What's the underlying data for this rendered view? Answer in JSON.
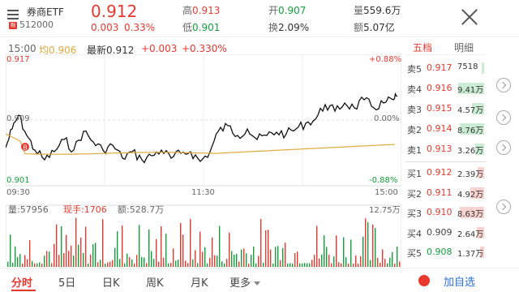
{
  "header": {
    "name": "券商ETF",
    "code_badge": "融",
    "code": "512000",
    "price": "0.912",
    "change": "0.003",
    "change_pct": "0.33%",
    "high_label": "高",
    "high": "0.913",
    "low_label": "低",
    "low": "0.901",
    "open_label": "开",
    "open": "0.907",
    "turnover_label": "换",
    "turnover": "2.09%",
    "volume_label": "量",
    "volume": "559.6万",
    "amount_label": "额",
    "amount": "5.07亿"
  },
  "info": {
    "time": "15:00",
    "avg_label": "均",
    "avg": "0.906",
    "latest_label": "最新",
    "latest": "0.912",
    "delta": "+0.003",
    "delta_pct": "+0.330%"
  },
  "axes": {
    "top_price": "0.917",
    "top_pct": "+0.88%",
    "mid_price": "0.909",
    "mid_pct": "0.00%",
    "bot_price": "0.901",
    "bot_pct": "-0.88%",
    "t_start": "09:30",
    "t_mid": "11:30",
    "t_end": "15:00",
    "marker": "B"
  },
  "volume": {
    "vol_label": "量:57956",
    "hand_label": "现手:1706",
    "amt_label": "额:528.7万",
    "max": "12.75万"
  },
  "orderbook": {
    "tabs": [
      "五档",
      "明细"
    ],
    "asks": [
      {
        "label": "卖5",
        "price": "0.917",
        "vol": "7518",
        "frac": 0.08
      },
      {
        "label": "卖4",
        "price": "0.916",
        "vol": "9.41万",
        "frac": 0.95
      },
      {
        "label": "卖3",
        "price": "0.915",
        "vol": "4.57万",
        "frac": 0.45
      },
      {
        "label": "卖2",
        "price": "0.914",
        "vol": "8.76万",
        "frac": 0.88
      },
      {
        "label": "卖1",
        "price": "0.913",
        "vol": "3.26万",
        "frac": 0.33
      }
    ],
    "bids": [
      {
        "label": "买1",
        "price": "0.912",
        "vol": "2.39万",
        "frac": 0.24
      },
      {
        "label": "买2",
        "price": "0.911",
        "vol": "4.92万",
        "frac": 0.5
      },
      {
        "label": "买3",
        "price": "0.910",
        "vol": "8.63万",
        "frac": 0.87
      },
      {
        "label": "买4",
        "price": "0.909",
        "vol": "2.64万",
        "frac": 0.27
      },
      {
        "label": "买5",
        "price": "0.908",
        "vol": "1.37万",
        "frac": 0.14
      }
    ]
  },
  "nav": {
    "items": [
      "分时",
      "5日",
      "日K",
      "周K",
      "月K",
      "更多"
    ],
    "add": "加自选"
  },
  "colors": {
    "up": "#e8382e",
    "down": "#13a03c",
    "avg": "#e0a93c",
    "accent": "#2b6fd6"
  }
}
